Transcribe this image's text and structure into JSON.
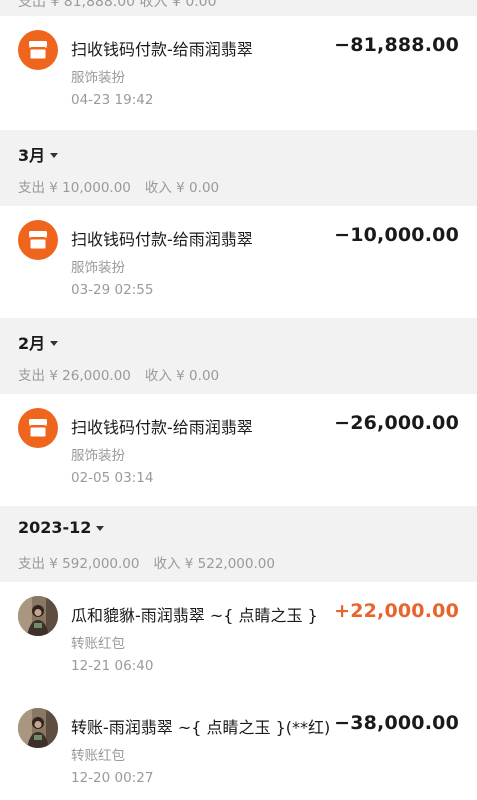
{
  "top_partial": {
    "text": "支出 ¥ 81,888.00   收入 ¥ 0.00"
  },
  "transactions_top": {
    "title": "扫收钱码付款-给雨润翡翠",
    "category": "服饰装扮",
    "time": "04-23  19:42",
    "amount": "−81,888.00",
    "icon": "shop-icon"
  },
  "months": [
    {
      "label": "3月",
      "expense": "支出 ¥ 10,000.00",
      "income": "收入 ¥ 0.00",
      "transactions": [
        {
          "title": "扫收钱码付款-给雨润翡翠",
          "category": "服饰装扮",
          "time": "03-29  02:55",
          "amount": "−10,000.00",
          "icon": "shop-icon"
        }
      ]
    },
    {
      "label": "2月",
      "expense": "支出 ¥ 26,000.00",
      "income": "收入 ¥ 0.00",
      "transactions": [
        {
          "title": "扫收钱码付款-给雨润翡翠",
          "category": "服饰装扮",
          "time": "02-05  03:14",
          "amount": "−26,000.00",
          "icon": "shop-icon"
        }
      ]
    },
    {
      "label": "2023-12",
      "expense": "支出 ¥ 592,000.00",
      "income": "收入 ¥ 522,000.00",
      "transactions": [
        {
          "title": "瓜和貔貅-雨润翡翠 ~{ 点睛之玉 }",
          "category": "转账红包",
          "time": "12-21  06:40",
          "amount": "+22,000.00",
          "icon": "avatar-photo"
        },
        {
          "title": "转账-雨润翡翠 ~{ 点睛之玉 }(**红)",
          "category": "转账红包",
          "time": "12-20  00:27",
          "amount": "−38,000.00",
          "icon": "avatar-photo"
        }
      ]
    }
  ],
  "colors": {
    "shop_icon_bg": "#f0651e",
    "income_amount": "#e8642a",
    "section_bg": "#f2f2f2",
    "muted_text": "#9a9a9a"
  }
}
